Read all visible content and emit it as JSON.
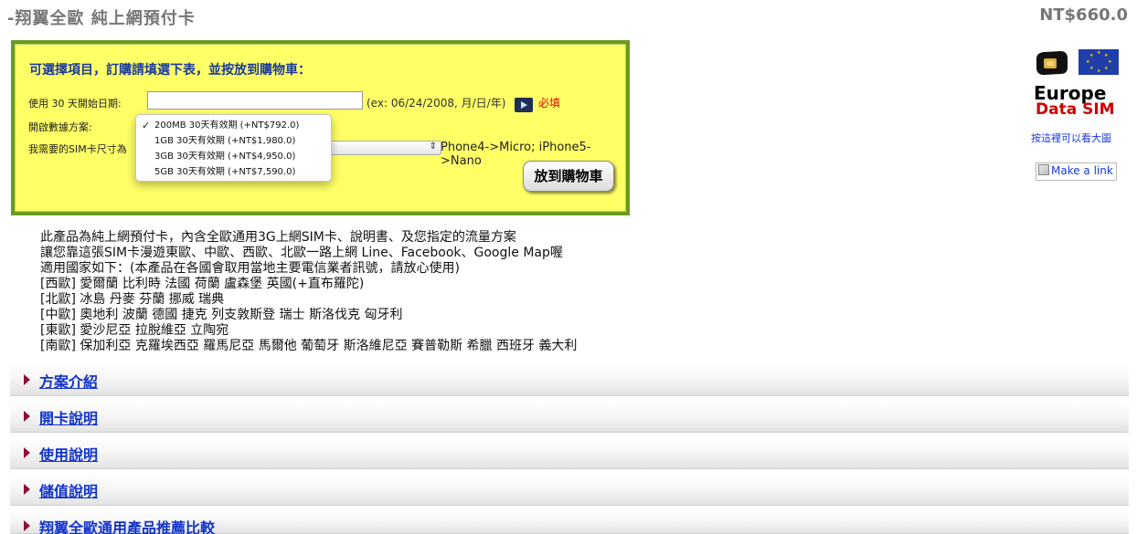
{
  "header": {
    "title": "-翔翼全歐 純上網預付卡",
    "price": "NT$660.0"
  },
  "order_form": {
    "heading": "可選擇項目，訂購請填選下表，並按放到購物車：",
    "start_date_label": "使用 30 天開始日期:",
    "start_date_value": "",
    "date_hint": "(ex: 06/24/2008, 月/日/年)",
    "required": "必填",
    "plan_label": "開啟數據方案:",
    "plan_options": [
      {
        "label": "200MB 30天有效期 (+NT$792.0)",
        "selected": true
      },
      {
        "label": "1GB 30天有效期 (+NT$1,980.0)",
        "selected": false
      },
      {
        "label": "3GB 30天有效期 (+NT$4,950.0)",
        "selected": false
      },
      {
        "label": "5GB 30天有效期 (+NT$7,590.0)",
        "selected": false
      }
    ],
    "sim_size_label": "我需要的SIM卡尺寸為",
    "sim_note": "Phone4->Micro; iPhone5->Nano",
    "cart_button": "放到購物車"
  },
  "sidebar": {
    "logo_line1": "Europe",
    "logo_line2": "Data SIM",
    "zoom_link": "按這裡可以看大圖",
    "broken_image_alt": "Make a link"
  },
  "description": [
    "此產品為純上網預付卡，內含全歐通用3G上網SIM卡、說明書、及您指定的流量方案",
    "讓您靠這張SIM卡漫遊東歐、中歐、西歐、北歐一路上網 Line、Facebook、Google Map喔",
    "適用國家如下：(本產品在各國會取用當地主要電信業者訊號，請放心使用)",
    "[西歐] 愛爾蘭 比利時 法國 荷蘭 盧森堡 英國(+直布羅陀)",
    "[北歐] 冰島 丹麥 芬蘭 挪威 瑞典",
    "[中歐] 奧地利 波蘭 德國 捷克 列支敦斯登 瑞士 斯洛伐克 匈牙利",
    "[東歐] 愛沙尼亞 拉脫維亞 立陶宛",
    "[南歐] 保加利亞 克羅埃西亞 羅馬尼亞 馬爾他 葡萄牙 斯洛維尼亞 賽普勒斯 希臘 西班牙 義大利"
  ],
  "sections": [
    {
      "title": "方案介紹"
    },
    {
      "title": "開卡說明"
    },
    {
      "title": "使用說明"
    },
    {
      "title": "儲值說明"
    },
    {
      "title": "翔翼全歐通用產品推薦比較"
    }
  ],
  "colors": {
    "form_background": "#ffff66",
    "form_border": "#6a9a1f",
    "link_blue": "#1133cc",
    "required_red": "#e00000"
  }
}
